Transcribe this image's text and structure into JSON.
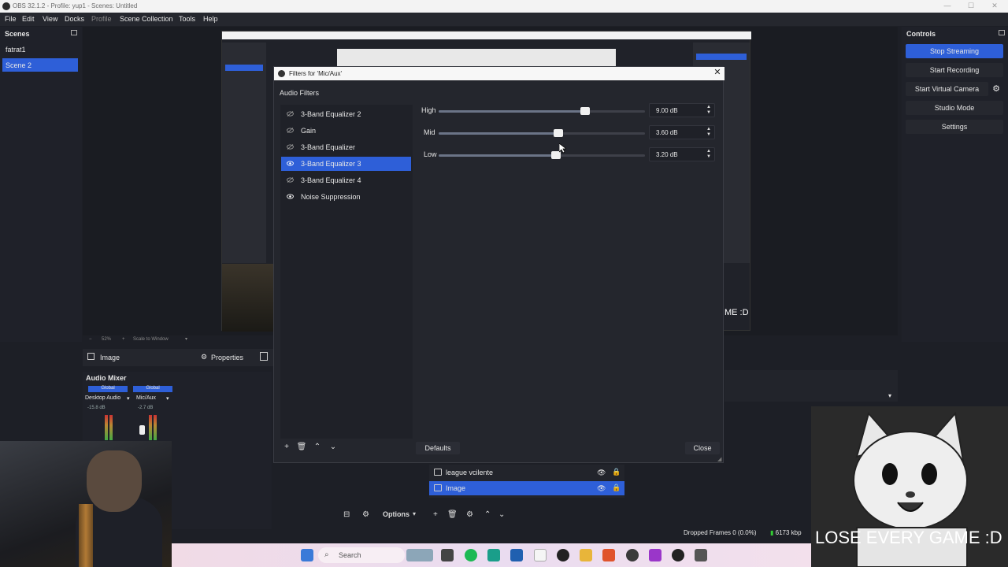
{
  "window": {
    "title": "OBS 32.1.2 - Profile: yup1 - Scenes: Untitled"
  },
  "menu": [
    "File",
    "Edit",
    "View",
    "Docks",
    "Profile",
    "Scene Collection",
    "Tools",
    "Help"
  ],
  "scenes": {
    "title": "Scenes",
    "items": [
      "fatrat1",
      "Scene 2"
    ]
  },
  "controls": {
    "title": "Controls",
    "buttons": [
      "Stop Streaming",
      "Start Recording",
      "Start Virtual Camera",
      "Studio Mode",
      "Settings"
    ]
  },
  "zoom": {
    "pct": "52%",
    "label": "Scale to Window"
  },
  "source_toolbar": {
    "name": "Image",
    "properties": "Properties"
  },
  "mixer": {
    "title": "Audio Mixer",
    "channels": [
      {
        "tab": "Global",
        "name": "Desktop Audio",
        "db": "-15.8 dB"
      },
      {
        "tab": "Global",
        "name": "Mic/Aux",
        "db": "-2.7 dB"
      }
    ]
  },
  "dialog": {
    "title": "Filters for 'Mic/Aux'",
    "section": "Audio Filters",
    "filters": [
      {
        "label": "3-Band Equalizer 2",
        "enabled": false
      },
      {
        "label": "Gain",
        "enabled": false
      },
      {
        "label": "3-Band Equalizer",
        "enabled": false
      },
      {
        "label": "3-Band Equalizer 3",
        "enabled": true
      },
      {
        "label": "3-Band Equalizer 4",
        "enabled": false
      },
      {
        "label": "Noise Suppression",
        "enabled": true
      }
    ],
    "sliders": [
      {
        "label": "High",
        "value": "9.00 dB",
        "level": 0.71
      },
      {
        "label": "Mid",
        "value": "3.60 dB",
        "level": 0.58
      },
      {
        "label": "Low",
        "value": "3.20 dB",
        "level": 0.57
      }
    ],
    "defaults": "Defaults",
    "close": "Close"
  },
  "sources": {
    "items": [
      "league vcilente",
      "Image"
    ],
    "options": "Options"
  },
  "status": {
    "dropped": "Dropped Frames 0 (0.0%)",
    "kbps": "6173 kbp"
  },
  "overlay": {
    "text": "LOSE EVERY GAME :D",
    "preview_text": "ME :D"
  },
  "taskbar": {
    "search": "Search"
  },
  "colors": {
    "accent": "#2e5fd8",
    "panel": "#1f2129",
    "dialog": "#24262d"
  }
}
